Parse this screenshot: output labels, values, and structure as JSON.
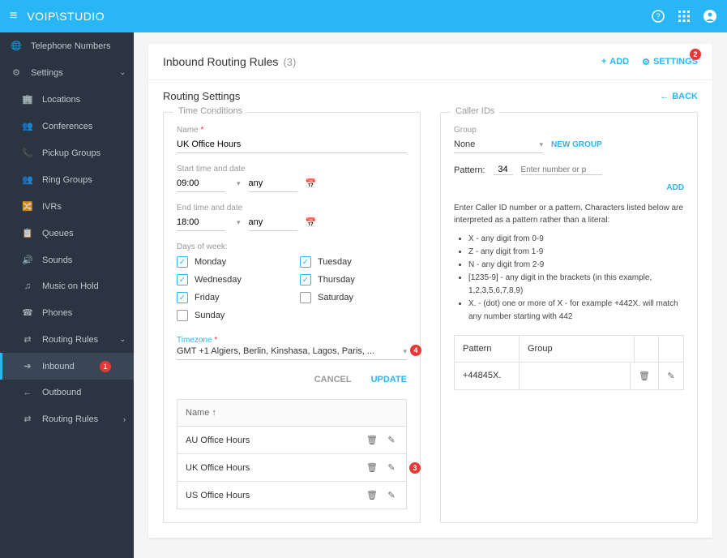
{
  "topbar": {
    "logo": "VOIP\\STUDIO"
  },
  "sidebar": {
    "telephone": "Telephone Numbers",
    "settings": "Settings",
    "locations": "Locations",
    "conferences": "Conferences",
    "pickup_groups": "Pickup Groups",
    "ring_groups": "Ring Groups",
    "ivrs": "IVRs",
    "queues": "Queues",
    "sounds": "Sounds",
    "music_on_hold": "Music on Hold",
    "phones": "Phones",
    "routing_rules": "Routing Rules",
    "inbound": "Inbound",
    "inbound_badge": "1",
    "outbound": "Outbound",
    "routing_rules_2": "Routing Rules"
  },
  "page": {
    "title": "Inbound Routing Rules",
    "count": "(3)",
    "add": "ADD",
    "settings": "SETTINGS",
    "settings_badge": "2",
    "subtitle": "Routing Settings",
    "back": "BACK"
  },
  "time": {
    "panel_title": "Time Conditions",
    "name_label": "Name",
    "name_value": "UK Office Hours",
    "start_label": "Start time and date",
    "start_value": "09:00",
    "end_label": "End time and date",
    "end_value": "18:00",
    "any": "any",
    "days_label": "Days of week:",
    "days": {
      "mon": "Monday",
      "tue": "Tuesday",
      "wed": "Wednesday",
      "thu": "Thursday",
      "fri": "Friday",
      "sat": "Saturday",
      "sun": "Sunday"
    },
    "tz_label": "Timezone",
    "tz_value": "GMT +1 Algiers, Berlin, Kinshasa, Lagos, Paris, ...",
    "tz_badge": "4",
    "cancel": "CANCEL",
    "update": "UPDATE",
    "table": {
      "name_header": "Name",
      "rows": [
        {
          "name": "AU Office Hours"
        },
        {
          "name": "UK Office Hours",
          "badge": "3"
        },
        {
          "name": "US Office Hours"
        }
      ]
    }
  },
  "caller": {
    "panel_title": "Caller IDs",
    "group_label": "Group",
    "group_value": "None",
    "new_group": "NEW GROUP",
    "pattern_label": "Pattern:",
    "pattern_prefix": "34",
    "pattern_placeholder": "Enter number or p",
    "add": "ADD",
    "help_intro": "Enter Caller ID number or a pattern. Characters listed below are interpreted as a pattern rather than a literal:",
    "help_items": [
      "X - any digit from 0-9",
      "Z - any digit from 1-9",
      "N - any digit from 2-9",
      "[1235-9] - any digit in the brackets (in this example, 1,2,3,5,6,7,8,9)",
      "X. - (dot) one or more of X - for example +442X. will match any number starting with 442"
    ],
    "table": {
      "pattern_header": "Pattern",
      "group_header": "Group",
      "rows": [
        {
          "pattern": "+44845X."
        }
      ]
    }
  }
}
